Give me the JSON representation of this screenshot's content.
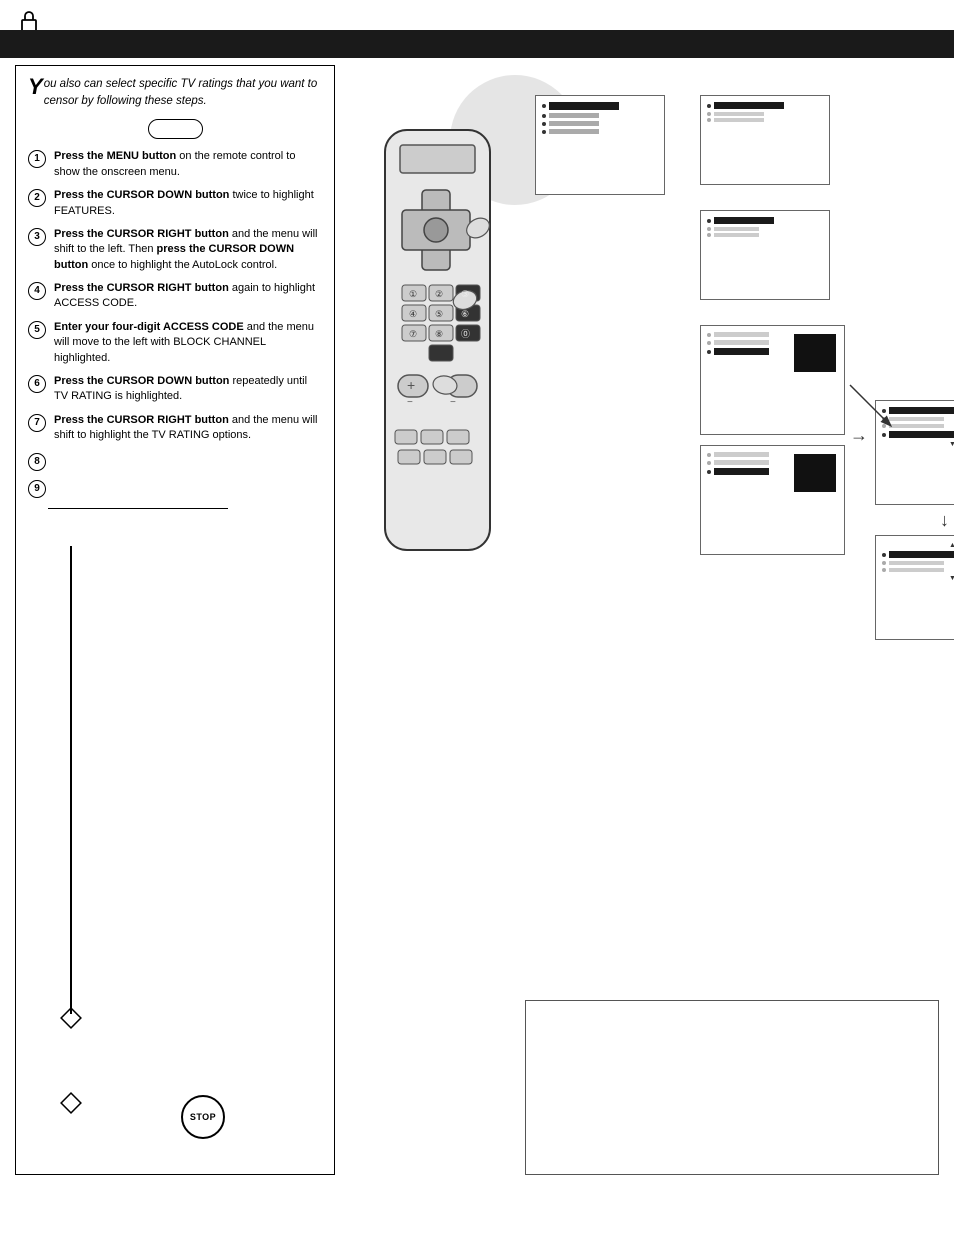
{
  "header": {
    "title": ""
  },
  "lock_icon": "🔒",
  "intro": {
    "text": "ou also can select specific TV ratings that you want to censor by following these steps."
  },
  "steps": [
    {
      "number": "1",
      "text_bold": "Press the MENU button",
      "text_normal": " on the remote control to show the onscreen menu."
    },
    {
      "number": "2",
      "text_bold": "Press the CURSOR DOWN button",
      "text_normal": " twice to highlight FEATURES."
    },
    {
      "number": "3",
      "text_bold": "Press the CURSOR RIGHT button",
      "text_normal": " and the menu will shift to the left. Then ",
      "text_bold2": "press the CURSOR DOWN button",
      "text_normal2": " once to highlight the AutoLock control."
    },
    {
      "number": "4",
      "text_bold": "Press the CURSOR RIGHT button",
      "text_normal": " again to highlight ACCESS CODE."
    },
    {
      "number": "5",
      "text_bold": "Enter your four-digit ACCESS CODE",
      "text_normal": " and the menu will move to the left with BLOCK CHANNEL highlighted."
    },
    {
      "number": "6",
      "text_bold": "Press the CURSOR DOWN button",
      "text_normal": " repeatedly until TV RATING is highlighted."
    },
    {
      "number": "7",
      "text_bold": "Press the CURSOR RIGHT button",
      "text_normal": " and the menu will shift to highlight the TV RATING options."
    },
    {
      "number": "8",
      "text_bold": "",
      "text_normal": ""
    },
    {
      "number": "9",
      "text_bold": "",
      "text_normal": ""
    }
  ],
  "stop_label": "STOP",
  "bottom_note": ""
}
